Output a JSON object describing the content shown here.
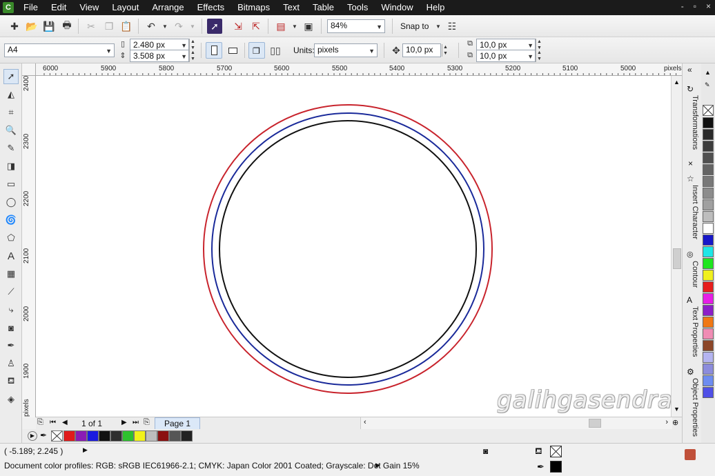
{
  "menubar": {
    "items": [
      "File",
      "Edit",
      "View",
      "Layout",
      "Arrange",
      "Effects",
      "Bitmaps",
      "Text",
      "Table",
      "Tools",
      "Window",
      "Help"
    ],
    "win_controls": [
      "-",
      "▫",
      "×"
    ]
  },
  "toolbar": {
    "zoom_value": "84%",
    "snap_label": "Snap to"
  },
  "property_bar": {
    "page_size": "A4",
    "width": "2.480 px",
    "height": "3.508 px",
    "units_label": "Units:",
    "units_value": "pixels",
    "nudge": "10,0 px",
    "dup_x": "10,0 px",
    "dup_y": "10,0 px"
  },
  "ruler_top": {
    "labels": [
      "6000",
      "5900",
      "5800",
      "5700",
      "5600",
      "5500",
      "5400",
      "5300",
      "5200",
      "5100",
      "5000"
    ],
    "unit": "pixels"
  },
  "ruler_left": {
    "labels": [
      "2400",
      "2300",
      "2200",
      "2100",
      "2000",
      "1900"
    ],
    "unit": "pixels"
  },
  "circles": [
    {
      "color": "#c8232c"
    },
    {
      "color": "#1a2a9a"
    },
    {
      "color": "#111111"
    }
  ],
  "pagebar": {
    "counter": "1 of 1",
    "tab": "Page 1"
  },
  "palette_colors": [
    "#e01b1b",
    "#8a1bb5",
    "#1b1be0",
    "#111111",
    "#2e2e2e",
    "#2ec12e",
    "#f2f21b",
    "#bdbdbd",
    "#8b1010",
    "#555555",
    "#222222"
  ],
  "dockers": [
    "Transformations",
    "Insert Character",
    "Contour",
    "Text Properties",
    "Object Properties"
  ],
  "vertical_palette": [
    "#111111",
    "#2a2a2a",
    "#3d3d3d",
    "#505050",
    "#646464",
    "#787878",
    "#8c8c8c",
    "#a0a0a0",
    "#bdbdbd",
    "#ffffff",
    "#1717c8",
    "#1ee6e6",
    "#1ee61e",
    "#f0f01e",
    "#e61e1e",
    "#e61ee6",
    "#8c1ec8",
    "#f07814",
    "#f08cb4",
    "#8c4628",
    "#b4b4f0",
    "#8c8cdc",
    "#6e8cf0",
    "#5050e6"
  ],
  "status": {
    "coords": "( -5.189; 2.245 )",
    "profiles": "Document color profiles: RGB: sRGB IEC61966-2.1; CMYK: Japan Color 2001 Coated; Grayscale: Dot Gain 15%"
  },
  "watermark": "galihgasendra"
}
